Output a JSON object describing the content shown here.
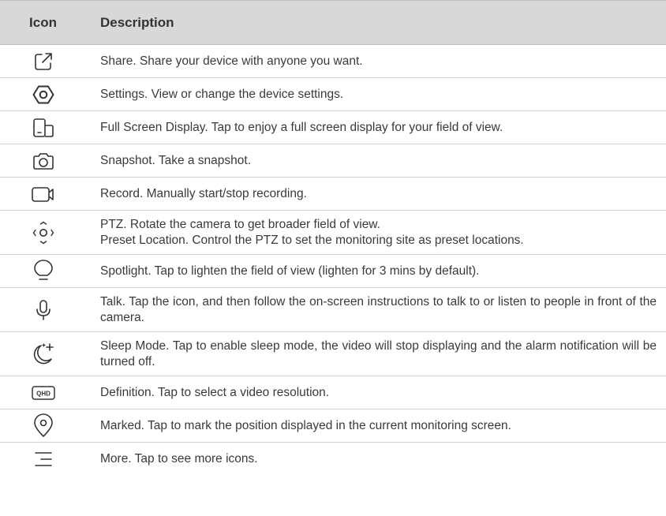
{
  "header": {
    "icon": "Icon",
    "description": "Description"
  },
  "rows": [
    {
      "icon": "share-icon",
      "text": "Share. Share your device with anyone you want."
    },
    {
      "icon": "settings-icon",
      "text": "Settings. View or change the device settings."
    },
    {
      "icon": "full-screen-icon",
      "text": "Full Screen Display. Tap to enjoy a full screen display for your field of view."
    },
    {
      "icon": "snapshot-icon",
      "text": "Snapshot. Take a snapshot."
    },
    {
      "icon": "record-icon",
      "text": "Record. Manually start/stop recording."
    },
    {
      "icon": "ptz-icon",
      "text": "PTZ. Rotate the camera to get broader field of view.\nPreset Location. Control the PTZ to set the monitoring site as preset locations."
    },
    {
      "icon": "spotlight-icon",
      "text": "Spotlight. Tap to lighten the field of view (lighten for 3 mins by default)."
    },
    {
      "icon": "microphone-icon",
      "text": "Talk. Tap the icon, and then follow the on-screen instructions to talk to or listen to people in front of the camera."
    },
    {
      "icon": "sleep-mode-icon",
      "text": "Sleep Mode. Tap to enable sleep mode, the video will stop displaying and the alarm notification will be turned off."
    },
    {
      "icon": "definition-icon",
      "label": "QHD",
      "text": "Definition. Tap to select a video resolution."
    },
    {
      "icon": "location-pin-icon",
      "text": "Marked. Tap to mark the position displayed in the current monitoring screen."
    },
    {
      "icon": "more-icon",
      "text": "More. Tap to see more icons."
    }
  ]
}
